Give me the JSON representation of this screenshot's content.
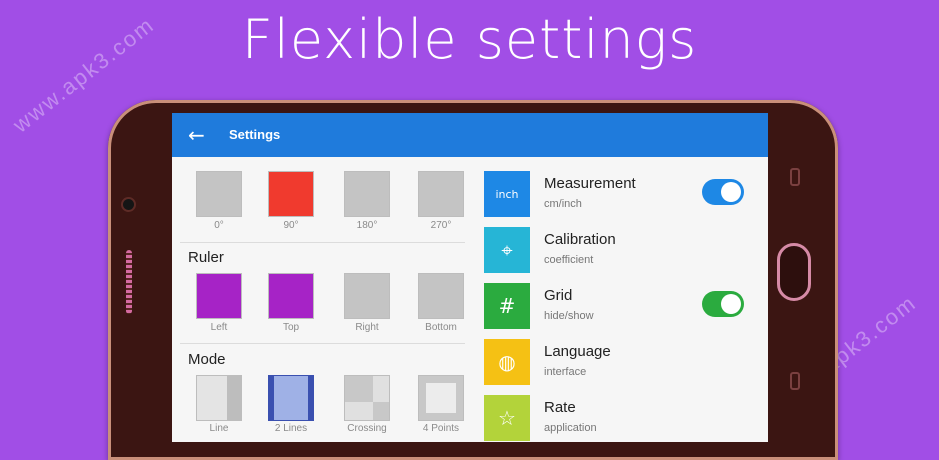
{
  "banner": {
    "headline": "Flexible settings",
    "watermark": "www.apk3.com"
  },
  "app": {
    "title": "Settings"
  },
  "orientation": {
    "items": [
      {
        "label": "0°",
        "color": "#c4c4c4",
        "selected": false
      },
      {
        "label": "90°",
        "color": "#f03a2e",
        "selected": true
      },
      {
        "label": "180°",
        "color": "#c4c4c4",
        "selected": false
      },
      {
        "label": "270°",
        "color": "#c4c4c4",
        "selected": false
      }
    ]
  },
  "ruler": {
    "title": "Ruler",
    "items": [
      {
        "label": "Left",
        "color": "#a623c6",
        "selected": true
      },
      {
        "label": "Top",
        "color": "#a623c6",
        "selected": true
      },
      {
        "label": "Right",
        "color": "#c4c4c4",
        "selected": false
      },
      {
        "label": "Bottom",
        "color": "#c4c4c4",
        "selected": false
      }
    ]
  },
  "mode": {
    "title": "Mode",
    "items": [
      {
        "label": "Line",
        "selected": false
      },
      {
        "label": "2 Lines",
        "selected": true
      },
      {
        "label": "Crossing",
        "selected": false
      },
      {
        "label": "4 Points",
        "selected": false
      }
    ]
  },
  "settings": [
    {
      "title": "Measurement",
      "subtitle": "cm/inch",
      "icon": "inch-icon",
      "icon_text": "inch",
      "color": "#1e88e5",
      "toggle": true,
      "toggle_on": true,
      "toggle_color": "#1e88e5"
    },
    {
      "title": "Calibration",
      "subtitle": "coefficient",
      "icon": "crosshair-icon",
      "icon_text": "⌖",
      "color": "#26b5d6",
      "toggle": false
    },
    {
      "title": "Grid",
      "subtitle": "hide/show",
      "icon": "grid-icon",
      "icon_text": "#",
      "color": "#2bab3f",
      "toggle": true,
      "toggle_on": true,
      "toggle_color": "#2bab3f"
    },
    {
      "title": "Language",
      "subtitle": "interface",
      "icon": "globe-icon",
      "icon_text": "◍",
      "color": "#f5c114",
      "toggle": false
    },
    {
      "title": "Rate",
      "subtitle": "application",
      "icon": "star-icon",
      "icon_text": "☆",
      "color": "#b3d33a",
      "toggle": false
    }
  ]
}
